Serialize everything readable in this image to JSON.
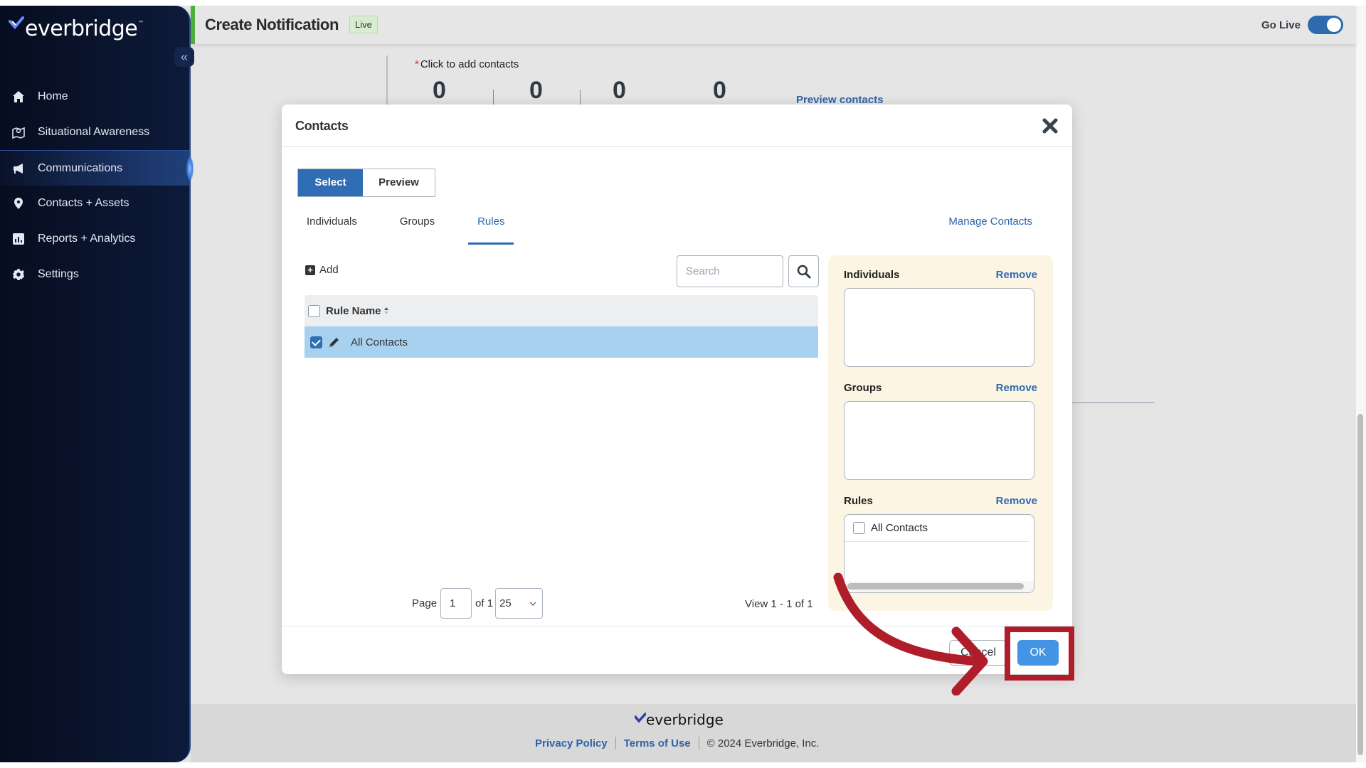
{
  "brand": {
    "name": "everbridge",
    "trademark": "™"
  },
  "sidebar": {
    "collapse_label": "«",
    "items": [
      {
        "label": "Home",
        "icon": "home-icon",
        "active": false
      },
      {
        "label": "Situational Awareness",
        "icon": "map-icon",
        "active": false
      },
      {
        "label": "Communications",
        "icon": "megaphone-icon",
        "active": true
      },
      {
        "label": "Contacts + Assets",
        "icon": "location-pin-icon",
        "active": false
      },
      {
        "label": "Reports + Analytics",
        "icon": "bar-chart-icon",
        "active": false
      },
      {
        "label": "Settings",
        "icon": "gear-icon",
        "active": false
      }
    ]
  },
  "header": {
    "title": "Create Notification",
    "badge": "Live",
    "go_live_label": "Go Live",
    "go_live_on": true
  },
  "background": {
    "click_to_add": "Click to add contacts",
    "required_mark": "*",
    "counts": [
      "0",
      "0",
      "0",
      "0"
    ],
    "preview_contacts": "Preview contacts"
  },
  "modal": {
    "title": "Contacts",
    "mode_tabs": {
      "select": "Select",
      "preview": "Preview",
      "active": "Select"
    },
    "tabs": [
      {
        "label": "Individuals",
        "active": false
      },
      {
        "label": "Groups",
        "active": false
      },
      {
        "label": "Rules",
        "active": true
      }
    ],
    "manage_contacts": "Manage Contacts",
    "add_label": "Add",
    "search_placeholder": "Search",
    "search_value": "",
    "table": {
      "columns": [
        "Rule Name"
      ],
      "rows": [
        {
          "name": "All Contacts",
          "checked": true
        }
      ]
    },
    "pager": {
      "page_label": "Page",
      "page": "1",
      "of_label": "of 1",
      "page_size": "25",
      "view_count": "View 1 - 1 of 1"
    },
    "selection": {
      "individuals": {
        "label": "Individuals",
        "remove": "Remove",
        "items": []
      },
      "groups": {
        "label": "Groups",
        "remove": "Remove",
        "items": []
      },
      "rules": {
        "label": "Rules",
        "remove": "Remove",
        "items": [
          "All Contacts"
        ]
      }
    },
    "cancel_label": "Cancel",
    "ok_label": "OK"
  },
  "footer": {
    "privacy": "Privacy Policy",
    "terms": "Terms of Use",
    "copyright": "© 2024 Everbridge, Inc."
  },
  "colors": {
    "accent": "#2e6ab0",
    "ok_button": "#4394e4",
    "selected_row": "#a8d1f0",
    "selection_panel": "#fdf5e4",
    "annotation": "#b01d2a",
    "live_border": "#4caf3c"
  }
}
